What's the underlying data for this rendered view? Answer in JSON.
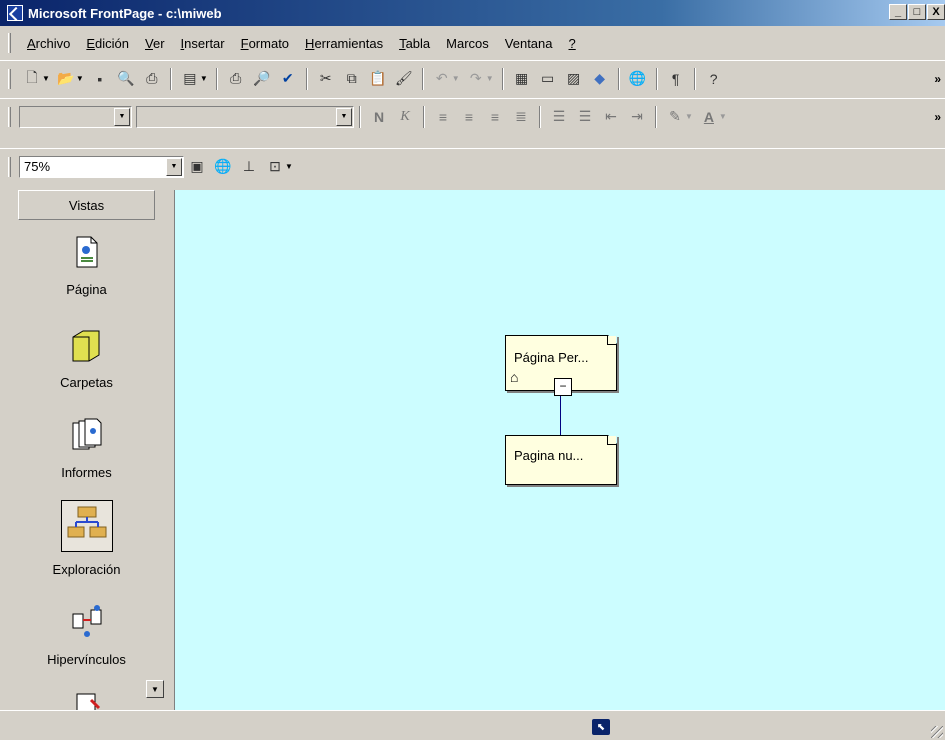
{
  "window": {
    "title": "Microsoft FrontPage - c:\\miweb",
    "minimize": "_",
    "maximize": "□",
    "close": "X"
  },
  "menu": [
    {
      "label": "Archivo",
      "u": "A",
      "rest": "rchivo"
    },
    {
      "label": "Edición",
      "u": "E",
      "rest": "dición"
    },
    {
      "label": "Ver",
      "u": "V",
      "rest": "er"
    },
    {
      "label": "Insertar",
      "u": "I",
      "rest": "nsertar"
    },
    {
      "label": "Formato",
      "u": "F",
      "rest": "ormato"
    },
    {
      "label": "Herramientas",
      "u": "H",
      "rest": "erramientas"
    },
    {
      "label": "Tabla",
      "u": "T",
      "rest": "abla"
    },
    {
      "label": "Marcos",
      "u": "",
      "rest": "Marcos"
    },
    {
      "label": "Ventana",
      "u": "",
      "rest": "Ventana"
    },
    {
      "label": "?",
      "u": "?",
      "rest": ""
    }
  ],
  "toolbar3": {
    "zoom_value": "75%"
  },
  "views": {
    "header": "Vistas",
    "items": [
      {
        "label": "Página",
        "icon": "page-view-icon"
      },
      {
        "label": "Carpetas",
        "icon": "folder-view-icon"
      },
      {
        "label": "Informes",
        "icon": "reports-view-icon"
      },
      {
        "label": "Exploración",
        "icon": "navigation-view-icon"
      },
      {
        "label": "Hipervínculos",
        "icon": "hyperlinks-view-icon"
      }
    ]
  },
  "navigation": {
    "root_node": "Página Per...",
    "child_node": "Pagina nu...",
    "collapse_symbol": "−"
  },
  "colors": {
    "canvas": "#ccfdff",
    "node": "#ffffe0",
    "titlebar": "#0a246a"
  }
}
